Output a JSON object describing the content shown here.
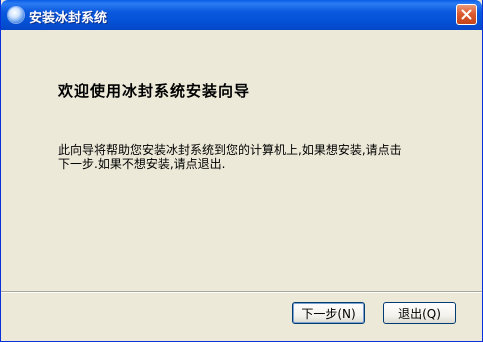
{
  "window": {
    "title": "安装冰封系统"
  },
  "wizard": {
    "heading": "欢迎使用冰封系统安装向导",
    "description_line1": "此向导将帮助您安装冰封系统到您的计算机上,如果想安装,请点击",
    "description_line2": "下一步.如果不想安装,请点退出."
  },
  "buttons": {
    "next_label": "下一步(N)",
    "quit_label": "退出(Q)"
  },
  "colors": {
    "titlebar": "#0a58de",
    "face": "#ece9d8",
    "close": "#dd5b2f"
  }
}
